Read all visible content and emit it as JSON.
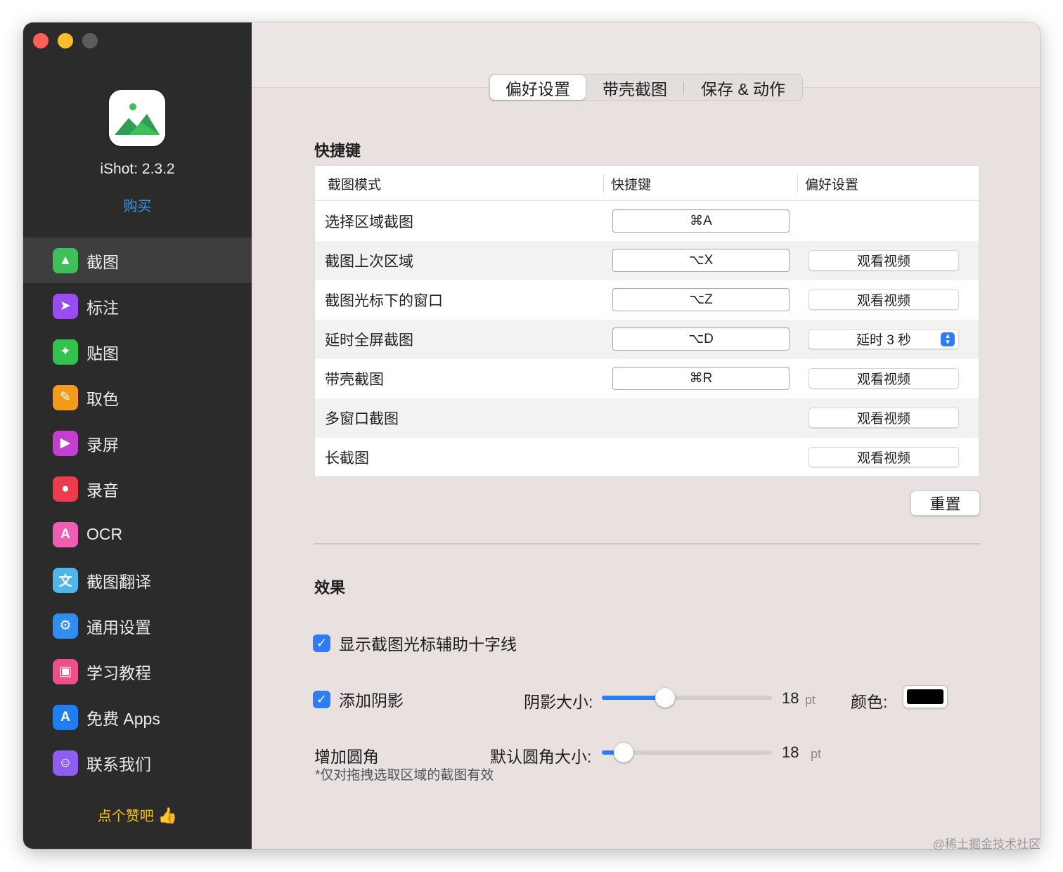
{
  "app": {
    "name": "iShot: 2.3.2",
    "buy_label": "购买",
    "like_label": "点个赞吧",
    "like_icon": "👍"
  },
  "sidebar": {
    "items": [
      {
        "label": "截图",
        "icon": "image-icon",
        "glyph": "▲",
        "color": "#3fbf5a",
        "active": true
      },
      {
        "label": "标注",
        "icon": "cursor-icon",
        "glyph": "➤",
        "color": "#9a4cf0",
        "active": false
      },
      {
        "label": "贴图",
        "icon": "pin-icon",
        "glyph": "✦",
        "color": "#33c24d",
        "active": false
      },
      {
        "label": "取色",
        "icon": "eyedropper-icon",
        "glyph": "✎",
        "color": "#f59b1b",
        "active": false
      },
      {
        "label": "录屏",
        "icon": "video-icon",
        "glyph": "▶",
        "color": "#c23fd0",
        "active": false
      },
      {
        "label": "录音",
        "icon": "microphone-icon",
        "glyph": "●",
        "color": "#ee3b4d",
        "active": false
      },
      {
        "label": "OCR",
        "icon": "ocr-icon",
        "glyph": "A",
        "color": "#ee5fb4",
        "active": false
      },
      {
        "label": "截图翻译",
        "icon": "translate-icon",
        "glyph": "文",
        "color": "#4fb6e8",
        "active": false
      },
      {
        "label": "通用设置",
        "icon": "gear-icon",
        "glyph": "⚙",
        "color": "#2f8ef0",
        "active": false
      },
      {
        "label": "学习教程",
        "icon": "tutorial-icon",
        "glyph": "▣",
        "color": "#ee4f8a",
        "active": false
      },
      {
        "label": "免费 Apps",
        "icon": "appstore-icon",
        "glyph": "A",
        "color": "#1f7ef0",
        "active": false
      },
      {
        "label": "联系我们",
        "icon": "contacts-icon",
        "glyph": "☺",
        "color": "#8f5ef0",
        "active": false
      }
    ]
  },
  "tabs": [
    {
      "label": "偏好设置",
      "active": true
    },
    {
      "label": "带壳截图",
      "active": false
    },
    {
      "label": "保存 & 动作",
      "active": false
    }
  ],
  "shortcuts": {
    "title": "快捷键",
    "headers": [
      "截图模式",
      "快捷键",
      "偏好设置"
    ],
    "rows": [
      {
        "name": "选择区域截图",
        "key": "⌘A",
        "pref": "",
        "pref_type": "none"
      },
      {
        "name": "截图上次区域",
        "key": "⌥X",
        "pref": "观看视频",
        "pref_type": "button"
      },
      {
        "name": "截图光标下的窗口",
        "key": "⌥Z",
        "pref": "观看视频",
        "pref_type": "button"
      },
      {
        "name": "延时全屏截图",
        "key": "⌥D",
        "pref": "延时 3 秒",
        "pref_type": "select"
      },
      {
        "name": "带壳截图",
        "key": "⌘R",
        "pref": "观看视频",
        "pref_type": "button"
      },
      {
        "name": "多窗口截图",
        "key": "",
        "pref": "观看视频",
        "pref_type": "button"
      },
      {
        "name": "长截图",
        "key": "",
        "pref": "观看视频",
        "pref_type": "button"
      }
    ],
    "reset_label": "重置"
  },
  "effects": {
    "title": "效果",
    "crosshair": {
      "label": "显示截图光标辅助十字线",
      "checked": true
    },
    "shadow": {
      "label": "添加阴影",
      "checked": true,
      "size_label": "阴影大小:",
      "value": "18",
      "unit": "pt",
      "slider_fraction": 0.37,
      "color_label": "颜色:",
      "color": "#000000"
    },
    "corner": {
      "label": "增加圆角",
      "size_label": "默认圆角大小:",
      "value": "18",
      "unit": "pt",
      "slider_fraction": 0.13,
      "note": "*仅对拖拽选取区域的截图有效"
    }
  },
  "colors": {
    "accent": "#2d7cf6",
    "sidebar_bg": "#2b2b2b",
    "buy_link": "#2f9bf0",
    "like": "#f5c21b"
  },
  "watermark": "@稀土掘金技术社区"
}
